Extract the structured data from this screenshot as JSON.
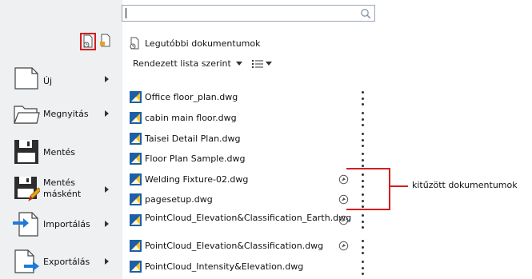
{
  "search": {
    "value": "",
    "placeholder": ""
  },
  "mode_buttons": [
    {
      "icon": "recent-documents-icon",
      "selected": true
    },
    {
      "icon": "open-documents-icon",
      "selected": false
    }
  ],
  "left_menu": [
    {
      "label": "Új",
      "icon": "new-document-icon",
      "has_submenu": true
    },
    {
      "label": "Megnyitás",
      "icon": "folder-open-icon",
      "has_submenu": true
    },
    {
      "label": "Mentés",
      "icon": "save-icon",
      "has_submenu": false
    },
    {
      "label": "Mentés\nmásként",
      "icon": "save-as-icon",
      "has_submenu": true
    },
    {
      "label": "Importálás",
      "icon": "import-icon",
      "has_submenu": true
    },
    {
      "label": "Exportálás",
      "icon": "export-icon",
      "has_submenu": true
    }
  ],
  "recent": {
    "title": "Legutóbbi dokumentumok",
    "sort_label": "Rendezett lista szerint",
    "documents": [
      {
        "name": "Office floor_plan.dwg",
        "pinned": false
      },
      {
        "name": "cabin main floor.dwg",
        "pinned": false
      },
      {
        "name": "Taisei Detail Plan.dwg",
        "pinned": false
      },
      {
        "name": "Floor Plan Sample.dwg",
        "pinned": false
      },
      {
        "name": "Welding Fixture-02.dwg",
        "pinned": true
      },
      {
        "name": "pagesetup.dwg",
        "pinned": true
      },
      {
        "name": "PointCloud_Elevation&Classification_Earth.dwg",
        "pinned": true
      },
      {
        "name": "PointCloud_Elevation&Classification.dwg",
        "pinned": true
      },
      {
        "name": "PointCloud_Intensity&Elevation.dwg",
        "pinned": false
      }
    ]
  },
  "annotation": {
    "text": "kitűzött dokumentumok"
  },
  "colors": {
    "highlight": "#d41e1e",
    "panel": "#eef0f2"
  }
}
